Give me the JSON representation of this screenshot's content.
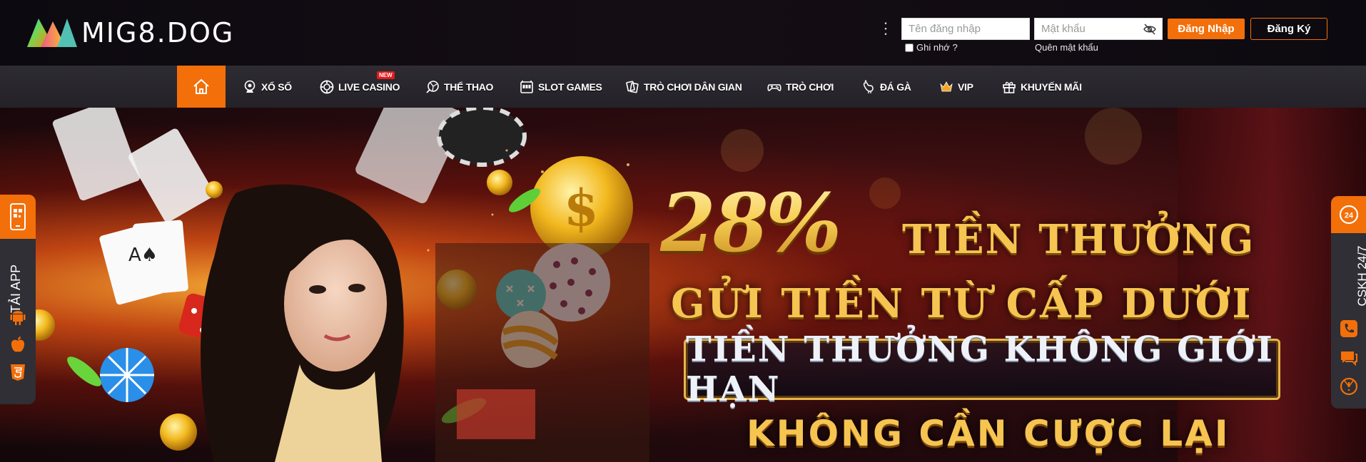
{
  "brand": {
    "name": "MIG8.DOG"
  },
  "auth": {
    "username_placeholder": "Tên đăng nhập",
    "password_placeholder": "Mật khẩu",
    "remember_label": "Ghi nhớ ?",
    "forgot_label": "Quên mật khẩu",
    "login_label": "Đăng Nhập",
    "register_label": "Đăng Ký"
  },
  "nav": {
    "items": [
      {
        "label": "XỔ SỐ",
        "icon": "lottery-ball-icon"
      },
      {
        "label": "LIVE CASINO",
        "icon": "casino-chip-icon",
        "badge": "NEW"
      },
      {
        "label": "THỂ THAO",
        "icon": "sports-ball-icon"
      },
      {
        "label": "SLOT GAMES",
        "icon": "slot-machine-icon"
      },
      {
        "label": "TRÒ CHƠI DÂN GIAN",
        "icon": "folk-game-icon"
      },
      {
        "label": "TRÒ CHƠI",
        "icon": "gamepad-icon"
      },
      {
        "label": "ĐÁ GÀ",
        "icon": "rooster-icon"
      },
      {
        "label": "VIP",
        "icon": "vip-crown-icon"
      },
      {
        "label": "KHUYẾN MÃI",
        "icon": "gift-icon"
      }
    ]
  },
  "banner": {
    "percent": "28%",
    "headline1": "TIỀN THƯỞNG",
    "headline2": "GỬI TIỀN TỪ CẤP DƯỚI",
    "subline": "TIỀN THƯỞNG KHÔNG GIỚI HẠN",
    "headline3": "KHÔNG CẦN CƯỢC LẠI"
  },
  "side_left": {
    "label": "TẢI APP"
  },
  "side_right": {
    "label": "CSKH 24/7",
    "badge": "24"
  },
  "colors": {
    "accent": "#f36f0a",
    "gold": "#f6c451",
    "nav_bg": "#2a282e"
  }
}
